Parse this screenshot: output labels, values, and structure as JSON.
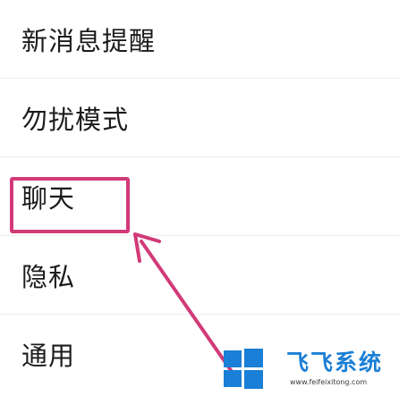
{
  "settings_menu": {
    "items": [
      {
        "label": "新消息提醒"
      },
      {
        "label": "勿扰模式"
      },
      {
        "label": "聊天"
      },
      {
        "label": "隐私"
      },
      {
        "label": "通用"
      }
    ],
    "highlighted_item": "聊天"
  },
  "annotation": {
    "box_color": "#d23a78",
    "arrow_color": "#d23a78"
  },
  "watermark": {
    "brand": "飞飞系统",
    "url": "www.feifeixitong.com",
    "logo_icon": "windows-logo-icon",
    "color": "#1a7fd6"
  }
}
